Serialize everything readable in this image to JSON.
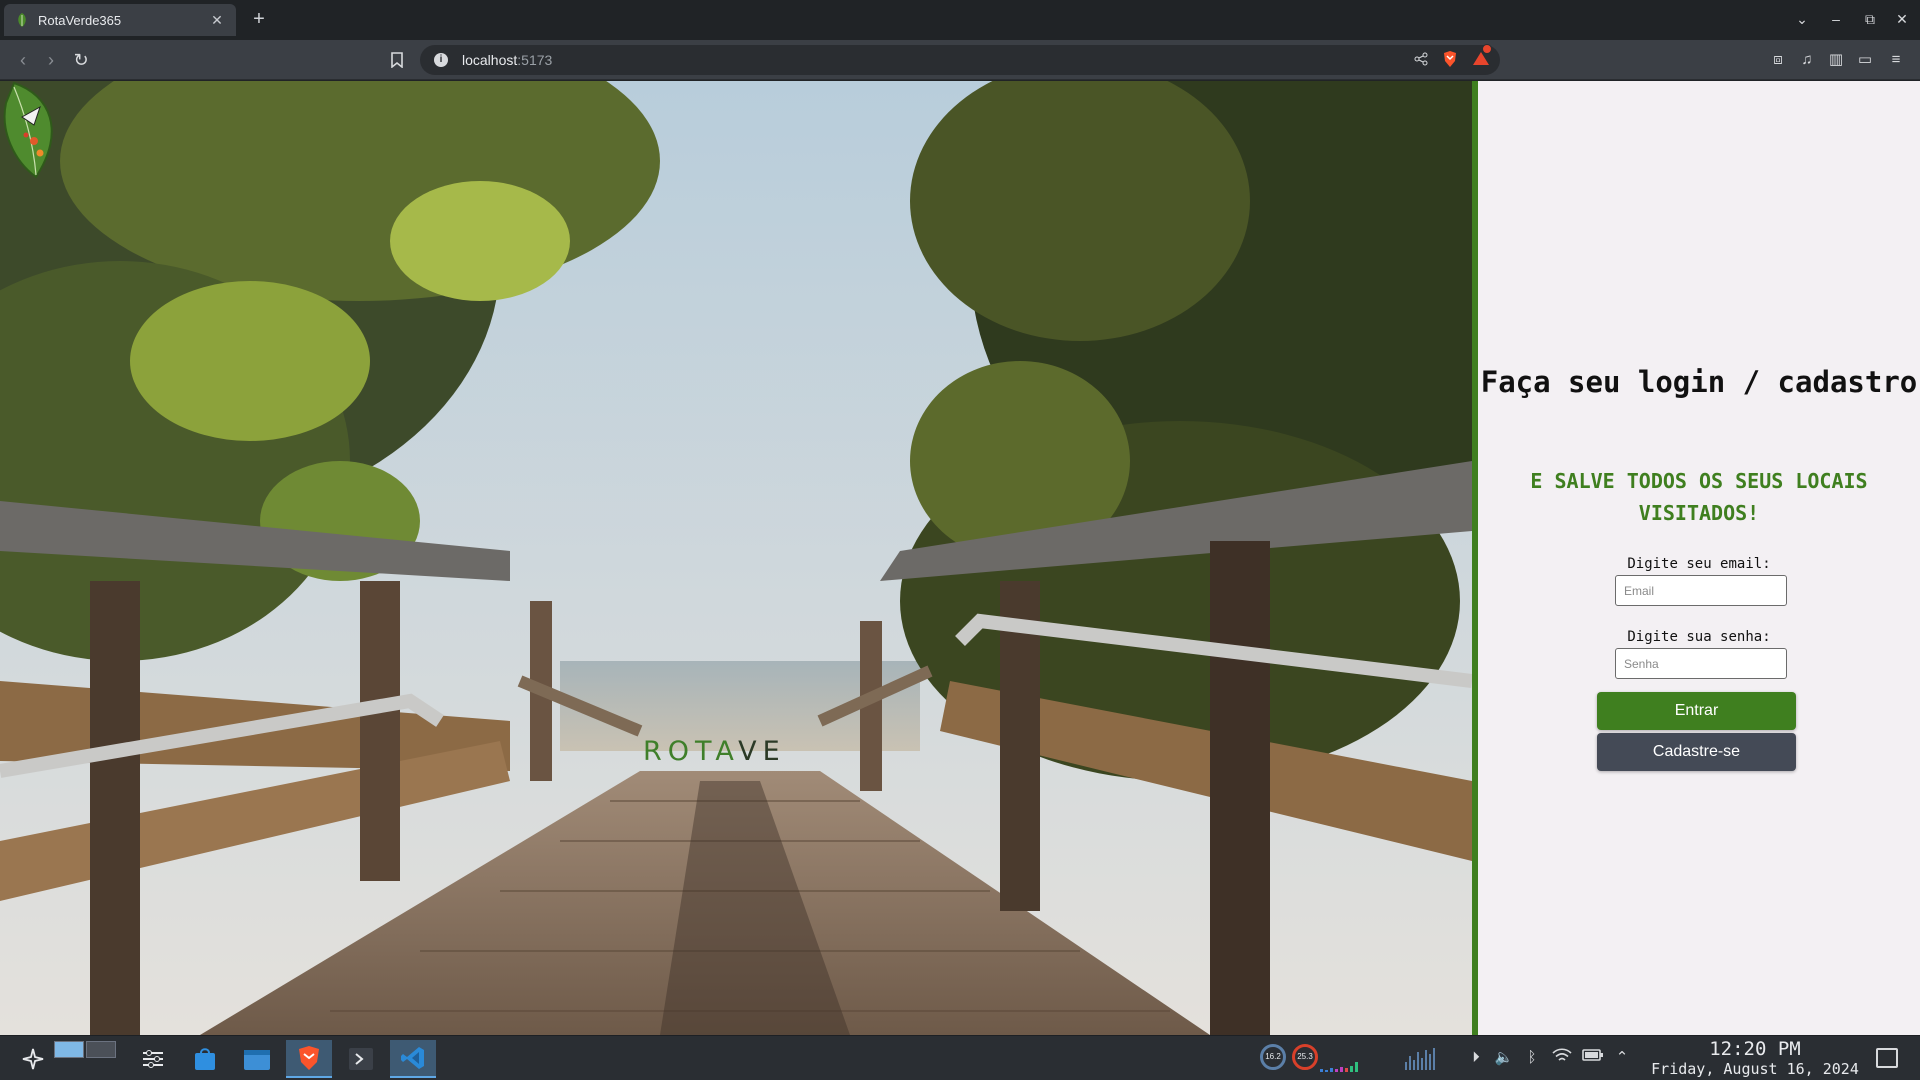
{
  "browser": {
    "tab": {
      "title": "RotaVerde365",
      "close": "✕"
    },
    "new_tab": "+",
    "address": {
      "host": "localhost",
      "port": ":5173"
    },
    "window_controls": [
      "chevron-down-icon",
      "minimize-icon",
      "restore-icon",
      "close-icon"
    ]
  },
  "hero": {
    "brand_first": "ROTA",
    "brand_rest": "VE",
    "logo_icon": "leaf-logo-icon"
  },
  "login": {
    "title": "Faça seu login / cadastro",
    "subtitle": "E SALVE TODOS OS SEUS LOCAIS VISITADOS!",
    "email_label": "Digite seu email:",
    "email_placeholder": "Email",
    "password_label": "Digite sua senha:",
    "password_placeholder": "Senha",
    "submit_label": "Entrar",
    "signup_label": "Cadastre-se"
  },
  "colors": {
    "accent": "#3f7f1f",
    "secondary_button": "#444a56",
    "panel_bg": "#f3f0f3"
  },
  "taskbar": {
    "tray_small_readouts": [
      "16.2",
      "25.3"
    ],
    "time": "12:20 PM",
    "date": "Friday, August 16, 2024"
  }
}
